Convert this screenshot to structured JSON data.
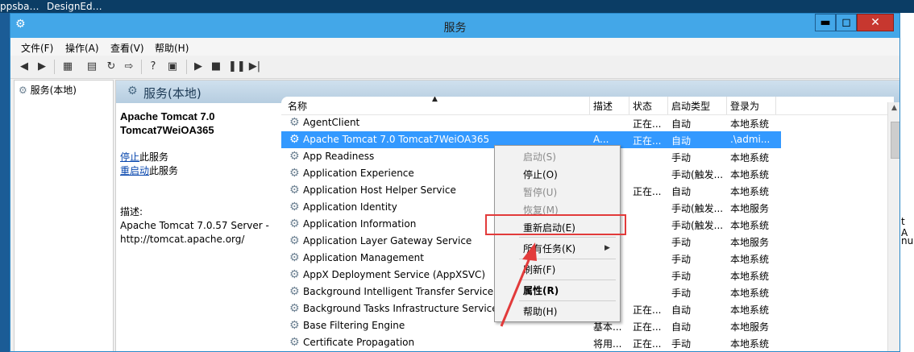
{
  "taskbar": {
    "left_text": "ppsba…",
    "right_text": "DesignEd…"
  },
  "window": {
    "title": "服务"
  },
  "menu": [
    "文件(F)",
    "操作(A)",
    "查看(V)",
    "帮助(H)"
  ],
  "tree": {
    "root": "服务(本地)"
  },
  "panel": {
    "header": "服务(本地)"
  },
  "description": {
    "title_line1": "Apache Tomcat 7.0",
    "title_line2": "Tomcat7WeiOA365",
    "stop_link": "停止",
    "stop_suffix": "此服务",
    "restart_link": "重启动",
    "restart_suffix": "此服务",
    "desc_label": "描述:",
    "desc_line1": "Apache Tomcat 7.0.57 Server -",
    "desc_line2": "http://tomcat.apache.org/"
  },
  "columns": {
    "name": "名称",
    "desc": "描述",
    "status": "状态",
    "startup": "启动类型",
    "logon": "登录为"
  },
  "rows": [
    {
      "name": "AgentClient",
      "desc": "",
      "status": "正在...",
      "startup": "自动",
      "logon": "本地系统"
    },
    {
      "name": "Apache Tomcat 7.0 Tomcat7WeiOA365",
      "desc": "A...",
      "status": "正在...",
      "startup": "自动",
      "logon": ".\\admi..."
    },
    {
      "name": "App Readiness",
      "desc": "...",
      "status": "",
      "startup": "手动",
      "logon": "本地系统"
    },
    {
      "name": "Application Experience",
      "desc": "...",
      "status": "",
      "startup": "手动(触发...",
      "logon": "本地系统"
    },
    {
      "name": "Application Host Helper Service",
      "desc": "...",
      "status": "正在...",
      "startup": "自动",
      "logon": "本地系统"
    },
    {
      "name": "Application Identity",
      "desc": "...",
      "status": "",
      "startup": "手动(触发...",
      "logon": "本地服务"
    },
    {
      "name": "Application Information",
      "desc": "...",
      "status": "",
      "startup": "手动(触发...",
      "logon": "本地系统"
    },
    {
      "name": "Application Layer Gateway Service",
      "desc": "...",
      "status": "",
      "startup": "手动",
      "logon": "本地服务"
    },
    {
      "name": "Application Management",
      "desc": "...",
      "status": "",
      "startup": "手动",
      "logon": "本地系统"
    },
    {
      "name": "AppX Deployment Service (AppXSVC)",
      "desc": "...",
      "status": "",
      "startup": "手动",
      "logon": "本地系统"
    },
    {
      "name": "Background Intelligent Transfer Service",
      "desc": "...",
      "status": "",
      "startup": "手动",
      "logon": "本地系统"
    },
    {
      "name": "Background Tasks Infrastructure Service",
      "desc": "...",
      "status": "正在...",
      "startup": "自动",
      "logon": "本地系统"
    },
    {
      "name": "Base Filtering Engine",
      "desc": "基本...",
      "status": "正在...",
      "startup": "自动",
      "logon": "本地服务"
    },
    {
      "name": "Certificate Propagation",
      "desc": "将用...",
      "status": "正在...",
      "startup": "手动",
      "logon": "本地系统"
    }
  ],
  "context_menu": {
    "start": "启动(S)",
    "stop": "停止(O)",
    "pause": "暂停(U)",
    "resume": "恢复(M)",
    "restart": "重新启动(E)",
    "all_tasks": "所有任务(K)",
    "refresh": "刷新(F)",
    "properties": "属性(R)",
    "help": "帮助(H)"
  },
  "desktop_right_glyphs": [
    "t A",
    "nu"
  ],
  "colors": {
    "titlebar": "#43a7e8",
    "selection": "#3399ff",
    "annotation": "#e23b3b"
  }
}
